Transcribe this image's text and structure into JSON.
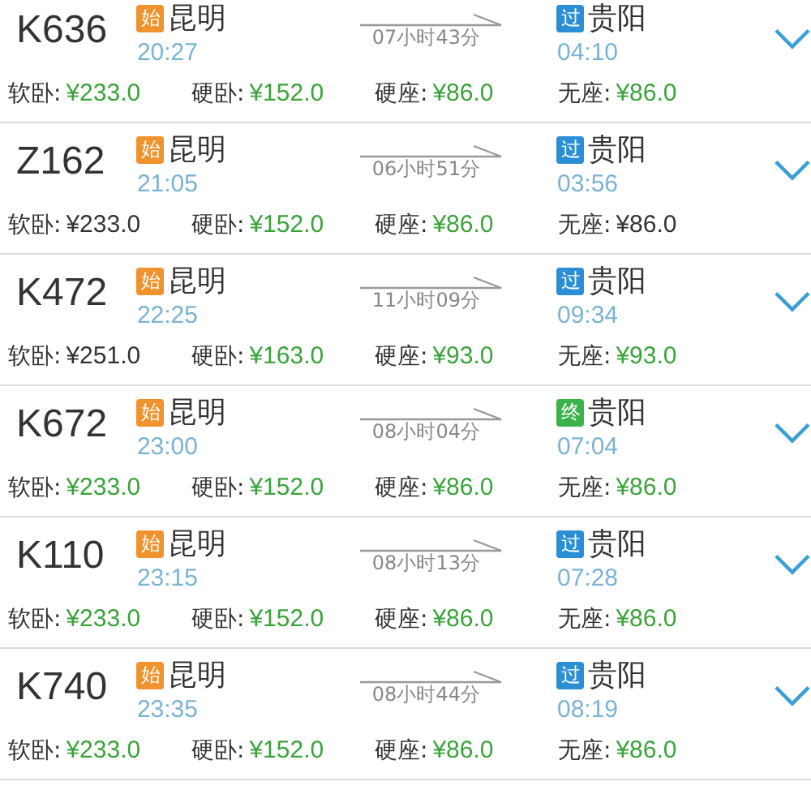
{
  "trains": [
    {
      "number": "K636",
      "from": {
        "badge": "始",
        "kind": "origin",
        "station": "昆明",
        "time": "20:27"
      },
      "duration": "07小时43分",
      "to": {
        "badge": "过",
        "kind": "pass",
        "station": "贵阳",
        "time": "04:10"
      },
      "fares": [
        {
          "label": "软卧:",
          "price": "¥233.0",
          "available": true
        },
        {
          "label": "硬卧:",
          "price": "¥152.0",
          "available": true
        },
        {
          "label": "硬座:",
          "price": "¥86.0",
          "available": true
        },
        {
          "label": "无座:",
          "price": "¥86.0",
          "available": true
        }
      ]
    },
    {
      "number": "Z162",
      "from": {
        "badge": "始",
        "kind": "origin",
        "station": "昆明",
        "time": "21:05"
      },
      "duration": "06小时51分",
      "to": {
        "badge": "过",
        "kind": "pass",
        "station": "贵阳",
        "time": "03:56"
      },
      "fares": [
        {
          "label": "软卧:",
          "price": "¥233.0",
          "available": false
        },
        {
          "label": "硬卧:",
          "price": "¥152.0",
          "available": true
        },
        {
          "label": "硬座:",
          "price": "¥86.0",
          "available": true
        },
        {
          "label": "无座:",
          "price": "¥86.0",
          "available": false
        }
      ]
    },
    {
      "number": "K472",
      "from": {
        "badge": "始",
        "kind": "origin",
        "station": "昆明",
        "time": "22:25"
      },
      "duration": "11小时09分",
      "to": {
        "badge": "过",
        "kind": "pass",
        "station": "贵阳",
        "time": "09:34"
      },
      "fares": [
        {
          "label": "软卧:",
          "price": "¥251.0",
          "available": false
        },
        {
          "label": "硬卧:",
          "price": "¥163.0",
          "available": true
        },
        {
          "label": "硬座:",
          "price": "¥93.0",
          "available": true
        },
        {
          "label": "无座:",
          "price": "¥93.0",
          "available": true
        }
      ]
    },
    {
      "number": "K672",
      "from": {
        "badge": "始",
        "kind": "origin",
        "station": "昆明",
        "time": "23:00"
      },
      "duration": "08小时04分",
      "to": {
        "badge": "终",
        "kind": "terminal",
        "station": "贵阳",
        "time": "07:04"
      },
      "fares": [
        {
          "label": "软卧:",
          "price": "¥233.0",
          "available": true
        },
        {
          "label": "硬卧:",
          "price": "¥152.0",
          "available": true
        },
        {
          "label": "硬座:",
          "price": "¥86.0",
          "available": true
        },
        {
          "label": "无座:",
          "price": "¥86.0",
          "available": true
        }
      ]
    },
    {
      "number": "K110",
      "from": {
        "badge": "始",
        "kind": "origin",
        "station": "昆明",
        "time": "23:15"
      },
      "duration": "08小时13分",
      "to": {
        "badge": "过",
        "kind": "pass",
        "station": "贵阳",
        "time": "07:28"
      },
      "fares": [
        {
          "label": "软卧:",
          "price": "¥233.0",
          "available": true
        },
        {
          "label": "硬卧:",
          "price": "¥152.0",
          "available": true
        },
        {
          "label": "硬座:",
          "price": "¥86.0",
          "available": true
        },
        {
          "label": "无座:",
          "price": "¥86.0",
          "available": true
        }
      ]
    },
    {
      "number": "K740",
      "from": {
        "badge": "始",
        "kind": "origin",
        "station": "昆明",
        "time": "23:35"
      },
      "duration": "08小时44分",
      "to": {
        "badge": "过",
        "kind": "pass",
        "station": "贵阳",
        "time": "08:19"
      },
      "fares": [
        {
          "label": "软卧:",
          "price": "¥233.0",
          "available": true
        },
        {
          "label": "硬卧:",
          "price": "¥152.0",
          "available": true
        },
        {
          "label": "硬座:",
          "price": "¥86.0",
          "available": true
        },
        {
          "label": "无座:",
          "price": "¥86.0",
          "available": true
        }
      ]
    }
  ]
}
